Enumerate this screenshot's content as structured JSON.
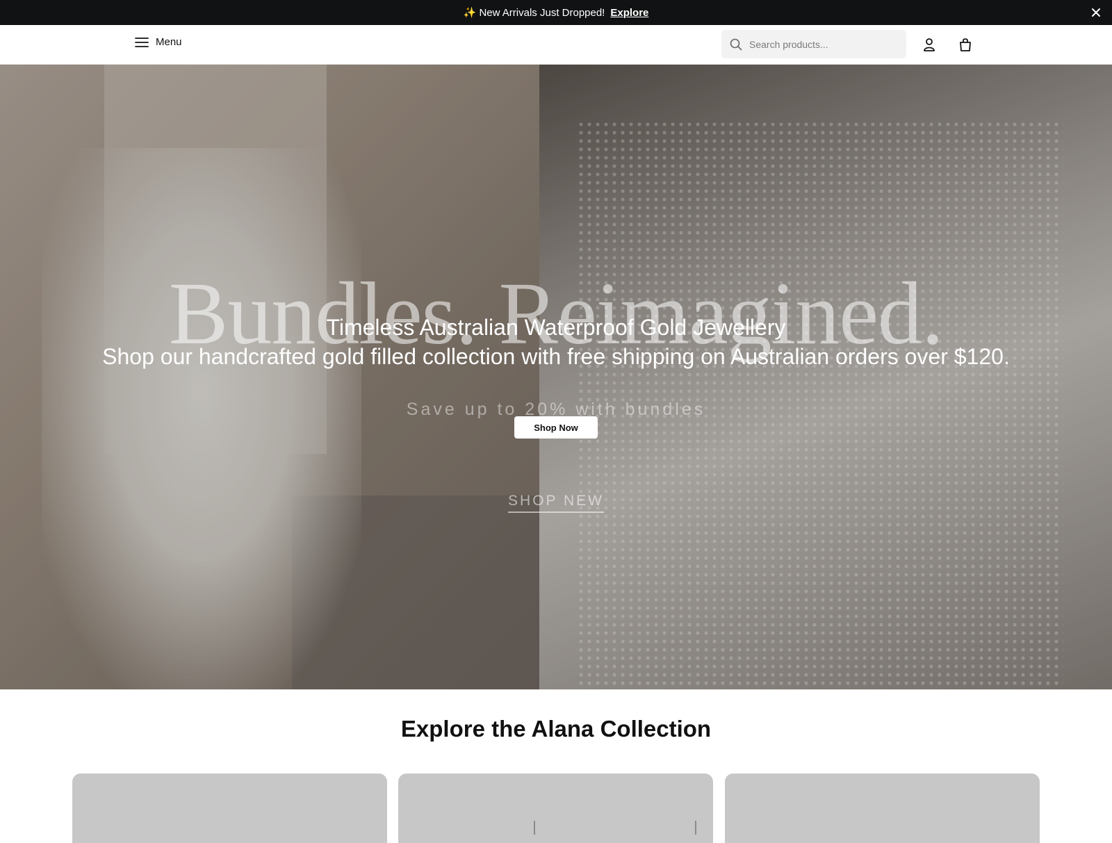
{
  "announcement": {
    "text": "✨ New Arrivals Just Dropped!",
    "link": "Explore"
  },
  "header": {
    "menu_label": "Menu",
    "search_placeholder": "Search products...",
    "icons": [
      "menu-icon",
      "search-icon",
      "account-icon",
      "bag-icon"
    ]
  },
  "hero": {
    "ghost_title": "Bundles. Reimagined.",
    "title": "Timeless Australian Waterproof Gold Jewellery",
    "subtitle": "Shop our handcrafted gold filled collection with free shipping on Australian orders over $120.",
    "ghost_subtitle": "Save up to 20% with bundles",
    "cta": "Shop Now",
    "secondary_cta": "SHOP NEW"
  },
  "collection": {
    "title": "Explore the Alana Collection",
    "cards": [
      {},
      {},
      {}
    ]
  },
  "colors": {
    "announcement_bg": "#111213",
    "card_bg": "#c7c7c7",
    "search_bg": "#f2f2f2"
  }
}
